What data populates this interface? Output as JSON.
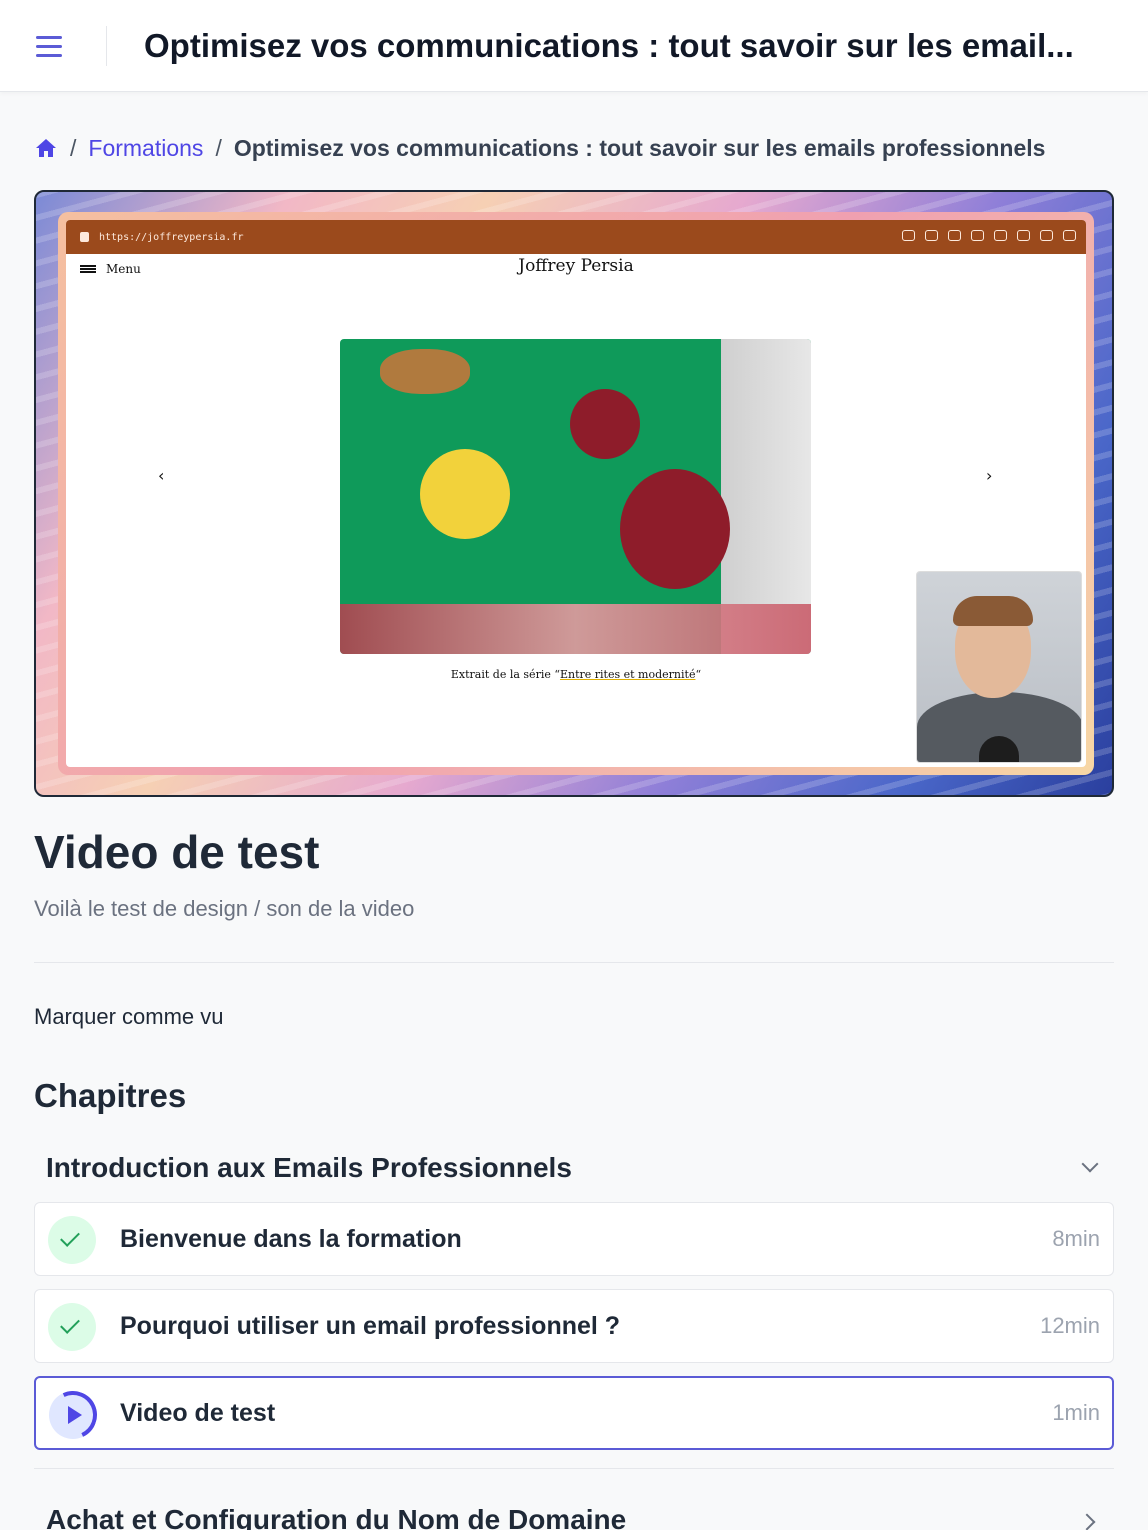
{
  "header": {
    "title": "Optimisez vos communications : tout savoir sur les email..."
  },
  "breadcrumb": {
    "home_icon": "home-icon",
    "items": [
      "Formations",
      "Optimisez vos communications : tout savoir sur les emails professionnels"
    ],
    "separator": "/"
  },
  "video": {
    "url": "https://joffreypersia.fr",
    "site_menu": "Menu",
    "site_name": "Joffrey Persia",
    "caption_prefix": "Extrait de la série “",
    "caption_link": "Entre rites et modernité",
    "caption_suffix": "“",
    "prev": "‹",
    "next": "›"
  },
  "lesson": {
    "title": "Video de test",
    "description": "Voilà le test de design / son de la video",
    "mark_seen": "Marquer comme vu"
  },
  "chapters": {
    "heading": "Chapitres",
    "sections": [
      {
        "title": "Introduction aux Emails Professionnels",
        "expanded": true,
        "lessons": [
          {
            "title": "Bienvenue dans la formation",
            "duration": "8min",
            "status": "completed"
          },
          {
            "title": "Pourquoi utiliser un email professionnel ?",
            "duration": "12min",
            "status": "completed"
          },
          {
            "title": "Video de test",
            "duration": "1min",
            "status": "current"
          }
        ]
      },
      {
        "title": "Achat et Configuration du Nom de Domaine",
        "expanded": false
      }
    ]
  },
  "colors": {
    "accent": "#5b5bd6",
    "link": "#4f46e5",
    "completed_bg": "#dcfce7",
    "completed_check": "#22a05a"
  }
}
